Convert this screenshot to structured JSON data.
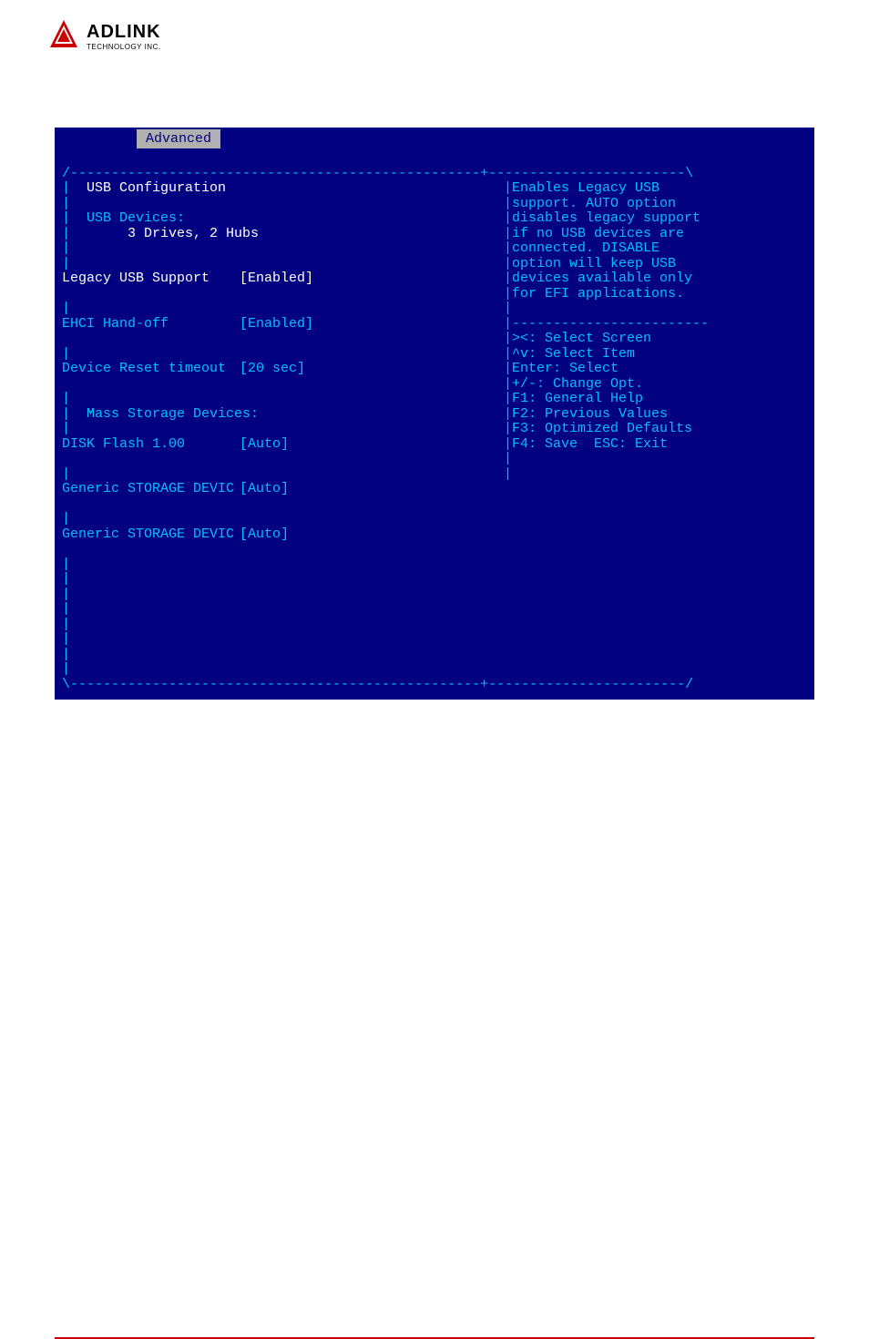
{
  "logo": {
    "main": "ADLINK",
    "sub": "TECHNOLOGY INC."
  },
  "tab": "Advanced",
  "border": {
    "top": "/--------------------------------------------------+------------------------\\",
    "divider_right": "|------------------------",
    "bottom": "\\--------------------------------------------------+------------------------/",
    "pipe": "|"
  },
  "left": {
    "title": "USB Configuration",
    "devices_label": "USB Devices:",
    "devices_value": "3 Drives, 2 Hubs",
    "settings": [
      {
        "label": "Legacy USB Support",
        "value": "[Enabled]",
        "selected": true
      },
      {
        "label": "EHCI Hand-off",
        "value": "[Enabled]",
        "selected": false
      },
      {
        "label": "Device Reset timeout",
        "value": "[20 sec]",
        "selected": false
      }
    ],
    "mass_label": "Mass Storage Devices:",
    "mass": [
      {
        "label": "DISK Flash 1.00",
        "value": "[Auto]"
      },
      {
        "label": "Generic STORAGE DEVIC",
        "value": "[Auto]"
      },
      {
        "label": "Generic STORAGE DEVIC",
        "value": "[Auto]"
      }
    ]
  },
  "right": {
    "help": [
      "Enables Legacy USB",
      "support. AUTO option",
      "disables legacy support",
      "if no USB devices are",
      "connected. DISABLE",
      "option will keep USB",
      "devices available only",
      "for EFI applications."
    ],
    "keys": [
      "><: Select Screen",
      "^v: Select Item",
      "Enter: Select",
      "+/-: Change Opt.",
      "F1: General Help",
      "F2: Previous Values",
      "F3: Optimized Defaults",
      "F4: Save  ESC: Exit"
    ]
  }
}
